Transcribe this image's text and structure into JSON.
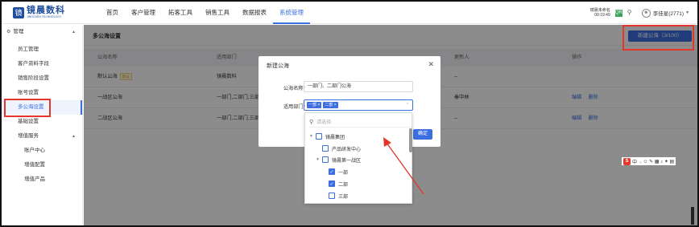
{
  "brand": {
    "logo_glyph": "镜",
    "name": "镜晨数科",
    "sub": "JINGCHEN TECHNOLOGY"
  },
  "nav": {
    "items": [
      {
        "label": "首页"
      },
      {
        "label": "客户管理"
      },
      {
        "label": "拓客工具"
      },
      {
        "label": "销售工具"
      },
      {
        "label": "数据报表"
      },
      {
        "label": "系统管理"
      }
    ],
    "active_index": 5
  },
  "header_right": {
    "login_line1": "镜晨未命名",
    "login_line2": "00:19:49",
    "square_icon": "QR",
    "search_icon": "search-icon",
    "user_name": "李佳星(2771)"
  },
  "sidebar": {
    "group_manage": "管理",
    "items": [
      {
        "label": "员工管理"
      },
      {
        "label": "客户资料字段"
      },
      {
        "label": "销售阶段设置"
      },
      {
        "label": "账号设置"
      },
      {
        "label": "多公海设置"
      },
      {
        "label": "基础设置"
      }
    ],
    "group_value": "增值服务",
    "sub_items": [
      {
        "label": "账户中心"
      },
      {
        "label": "增值配置"
      },
      {
        "label": "增值产品"
      }
    ]
  },
  "main": {
    "title": "多公海设置",
    "new_button": "新建公海（3/100）",
    "columns": [
      "公海名称",
      "适用部门",
      "更新人",
      "操作"
    ],
    "rows": [
      {
        "name": "默认公海",
        "tag": "默认",
        "dept": "镜晨数科",
        "updater": "--",
        "ops": []
      },
      {
        "name": "一战区公海",
        "tag": "",
        "dept": "一部门,二部门,三部门,四部",
        "updater": "秦中林",
        "ops": [
          "编辑",
          "删除"
        ]
      },
      {
        "name": "二战区公海",
        "tag": "",
        "dept": "一部门,二部门,三部门,四部",
        "updater": "--",
        "ops": [
          "编辑",
          "删除"
        ]
      }
    ]
  },
  "modal": {
    "title": "新建公海",
    "name_label": "公海名称",
    "name_value": "一部门、二部门公海",
    "dept_label": "适用部门",
    "selected_chips": [
      "一部",
      "二部"
    ],
    "ok_button": "确定"
  },
  "dropdown": {
    "search_placeholder": "请选择",
    "tree": [
      {
        "label": "镜晨集团",
        "checked": false,
        "level": 0,
        "expand": "▼"
      },
      {
        "label": "产品研发中心",
        "checked": false,
        "level": 1,
        "expand": ""
      },
      {
        "label": "镜晨第一战区",
        "checked": false,
        "level": 1,
        "expand": "▼"
      },
      {
        "label": "一部",
        "checked": true,
        "level": 2,
        "expand": ""
      },
      {
        "label": "二部",
        "checked": true,
        "level": 2,
        "expand": ""
      },
      {
        "label": "三部",
        "checked": false,
        "level": 2,
        "expand": ""
      }
    ]
  },
  "ime": {
    "label": "中",
    "extras": "·, ☺ ✎ ▦ ♪ ✦ ▤"
  },
  "colors": {
    "accent": "#3b6ee0",
    "highlight": "#e4362b"
  }
}
